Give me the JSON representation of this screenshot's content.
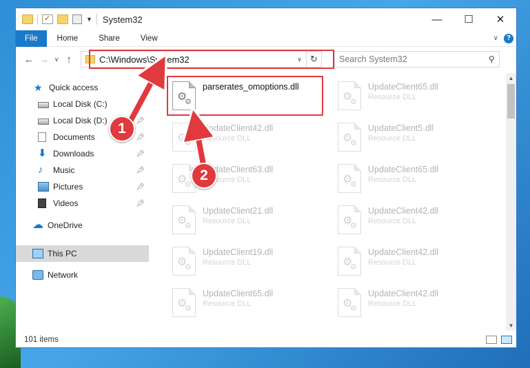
{
  "window": {
    "title": "System32",
    "controls": {
      "minimize": "—",
      "maximize": "☐",
      "close": "✕"
    }
  },
  "ribbon": {
    "tabs": [
      "File",
      "Home",
      "Share",
      "View"
    ],
    "help": "?"
  },
  "address": {
    "path": "C:\\Windows\\System32",
    "search_placeholder": "Search System32"
  },
  "nav": {
    "items": [
      {
        "label": "Quick access",
        "icon": "star-icon",
        "pinned": false
      },
      {
        "label": "Local Disk (C:)",
        "icon": "drive-icon",
        "pinned": true
      },
      {
        "label": "Local Disk (D:)",
        "icon": "drive-icon",
        "pinned": true
      },
      {
        "label": "Documents",
        "icon": "documents-icon",
        "pinned": true
      },
      {
        "label": "Downloads",
        "icon": "downloads-icon",
        "pinned": true
      },
      {
        "label": "Music",
        "icon": "music-icon",
        "pinned": true
      },
      {
        "label": "Pictures",
        "icon": "pictures-icon",
        "pinned": true
      },
      {
        "label": "Videos",
        "icon": "videos-icon",
        "pinned": true
      },
      {
        "label": "OneDrive",
        "icon": "onedrive-icon",
        "pinned": false
      },
      {
        "label": "This PC",
        "icon": "this-pc-icon",
        "pinned": false,
        "selected": true
      },
      {
        "label": "Network",
        "icon": "network-icon",
        "pinned": false
      }
    ]
  },
  "files": [
    {
      "name": "parserates_omoptions.dll",
      "type": ""
    },
    {
      "name": "UpdateClient65.dll",
      "type": "Resource DLL"
    },
    {
      "name": "UpdateClient42.dll",
      "type": "Resource DLL"
    },
    {
      "name": "UpdateClient5.dll",
      "type": "Resource DLL"
    },
    {
      "name": "UpdateClient63.dll",
      "type": "Resource DLL"
    },
    {
      "name": "UpdateClient65.dll",
      "type": "Resource DLL"
    },
    {
      "name": "UpdateClient21.dll",
      "type": "Resource DLL"
    },
    {
      "name": "UpdateClient42.dll",
      "type": "Resource DLL"
    },
    {
      "name": "UpdateClient19.dll",
      "type": "Resource DLL"
    },
    {
      "name": "UpdateClient42.dll",
      "type": "Resource DLL"
    },
    {
      "name": "UpdateClient65.dll",
      "type": "Resource DLL"
    },
    {
      "name": "UpdateClient42.dll",
      "type": "Resource DLL"
    }
  ],
  "status": {
    "item_count": "101 items"
  },
  "annotations": {
    "step1": "1",
    "step2": "2",
    "color": "#e0393e"
  },
  "colors": {
    "accent": "#1979ca",
    "highlight": "#e0393e"
  }
}
